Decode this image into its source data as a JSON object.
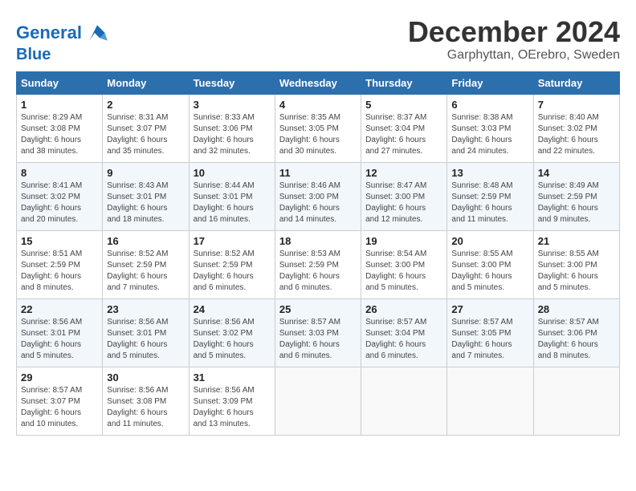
{
  "header": {
    "logo_line1": "General",
    "logo_line2": "Blue",
    "month_title": "December 2024",
    "location": "Garphyttan, OErebro, Sweden"
  },
  "days_of_week": [
    "Sunday",
    "Monday",
    "Tuesday",
    "Wednesday",
    "Thursday",
    "Friday",
    "Saturday"
  ],
  "weeks": [
    [
      {
        "day": 1,
        "info": "Sunrise: 8:29 AM\nSunset: 3:08 PM\nDaylight: 6 hours\nand 38 minutes."
      },
      {
        "day": 2,
        "info": "Sunrise: 8:31 AM\nSunset: 3:07 PM\nDaylight: 6 hours\nand 35 minutes."
      },
      {
        "day": 3,
        "info": "Sunrise: 8:33 AM\nSunset: 3:06 PM\nDaylight: 6 hours\nand 32 minutes."
      },
      {
        "day": 4,
        "info": "Sunrise: 8:35 AM\nSunset: 3:05 PM\nDaylight: 6 hours\nand 30 minutes."
      },
      {
        "day": 5,
        "info": "Sunrise: 8:37 AM\nSunset: 3:04 PM\nDaylight: 6 hours\nand 27 minutes."
      },
      {
        "day": 6,
        "info": "Sunrise: 8:38 AM\nSunset: 3:03 PM\nDaylight: 6 hours\nand 24 minutes."
      },
      {
        "day": 7,
        "info": "Sunrise: 8:40 AM\nSunset: 3:02 PM\nDaylight: 6 hours\nand 22 minutes."
      }
    ],
    [
      {
        "day": 8,
        "info": "Sunrise: 8:41 AM\nSunset: 3:02 PM\nDaylight: 6 hours\nand 20 minutes."
      },
      {
        "day": 9,
        "info": "Sunrise: 8:43 AM\nSunset: 3:01 PM\nDaylight: 6 hours\nand 18 minutes."
      },
      {
        "day": 10,
        "info": "Sunrise: 8:44 AM\nSunset: 3:01 PM\nDaylight: 6 hours\nand 16 minutes."
      },
      {
        "day": 11,
        "info": "Sunrise: 8:46 AM\nSunset: 3:00 PM\nDaylight: 6 hours\nand 14 minutes."
      },
      {
        "day": 12,
        "info": "Sunrise: 8:47 AM\nSunset: 3:00 PM\nDaylight: 6 hours\nand 12 minutes."
      },
      {
        "day": 13,
        "info": "Sunrise: 8:48 AM\nSunset: 2:59 PM\nDaylight: 6 hours\nand 11 minutes."
      },
      {
        "day": 14,
        "info": "Sunrise: 8:49 AM\nSunset: 2:59 PM\nDaylight: 6 hours\nand 9 minutes."
      }
    ],
    [
      {
        "day": 15,
        "info": "Sunrise: 8:51 AM\nSunset: 2:59 PM\nDaylight: 6 hours\nand 8 minutes."
      },
      {
        "day": 16,
        "info": "Sunrise: 8:52 AM\nSunset: 2:59 PM\nDaylight: 6 hours\nand 7 minutes."
      },
      {
        "day": 17,
        "info": "Sunrise: 8:52 AM\nSunset: 2:59 PM\nDaylight: 6 hours\nand 6 minutes."
      },
      {
        "day": 18,
        "info": "Sunrise: 8:53 AM\nSunset: 2:59 PM\nDaylight: 6 hours\nand 6 minutes."
      },
      {
        "day": 19,
        "info": "Sunrise: 8:54 AM\nSunset: 3:00 PM\nDaylight: 6 hours\nand 5 minutes."
      },
      {
        "day": 20,
        "info": "Sunrise: 8:55 AM\nSunset: 3:00 PM\nDaylight: 6 hours\nand 5 minutes."
      },
      {
        "day": 21,
        "info": "Sunrise: 8:55 AM\nSunset: 3:00 PM\nDaylight: 6 hours\nand 5 minutes."
      }
    ],
    [
      {
        "day": 22,
        "info": "Sunrise: 8:56 AM\nSunset: 3:01 PM\nDaylight: 6 hours\nand 5 minutes."
      },
      {
        "day": 23,
        "info": "Sunrise: 8:56 AM\nSunset: 3:01 PM\nDaylight: 6 hours\nand 5 minutes."
      },
      {
        "day": 24,
        "info": "Sunrise: 8:56 AM\nSunset: 3:02 PM\nDaylight: 6 hours\nand 5 minutes."
      },
      {
        "day": 25,
        "info": "Sunrise: 8:57 AM\nSunset: 3:03 PM\nDaylight: 6 hours\nand 6 minutes."
      },
      {
        "day": 26,
        "info": "Sunrise: 8:57 AM\nSunset: 3:04 PM\nDaylight: 6 hours\nand 6 minutes."
      },
      {
        "day": 27,
        "info": "Sunrise: 8:57 AM\nSunset: 3:05 PM\nDaylight: 6 hours\nand 7 minutes."
      },
      {
        "day": 28,
        "info": "Sunrise: 8:57 AM\nSunset: 3:06 PM\nDaylight: 6 hours\nand 8 minutes."
      }
    ],
    [
      {
        "day": 29,
        "info": "Sunrise: 8:57 AM\nSunset: 3:07 PM\nDaylight: 6 hours\nand 10 minutes."
      },
      {
        "day": 30,
        "info": "Sunrise: 8:56 AM\nSunset: 3:08 PM\nDaylight: 6 hours\nand 11 minutes."
      },
      {
        "day": 31,
        "info": "Sunrise: 8:56 AM\nSunset: 3:09 PM\nDaylight: 6 hours\nand 13 minutes."
      },
      null,
      null,
      null,
      null
    ]
  ]
}
